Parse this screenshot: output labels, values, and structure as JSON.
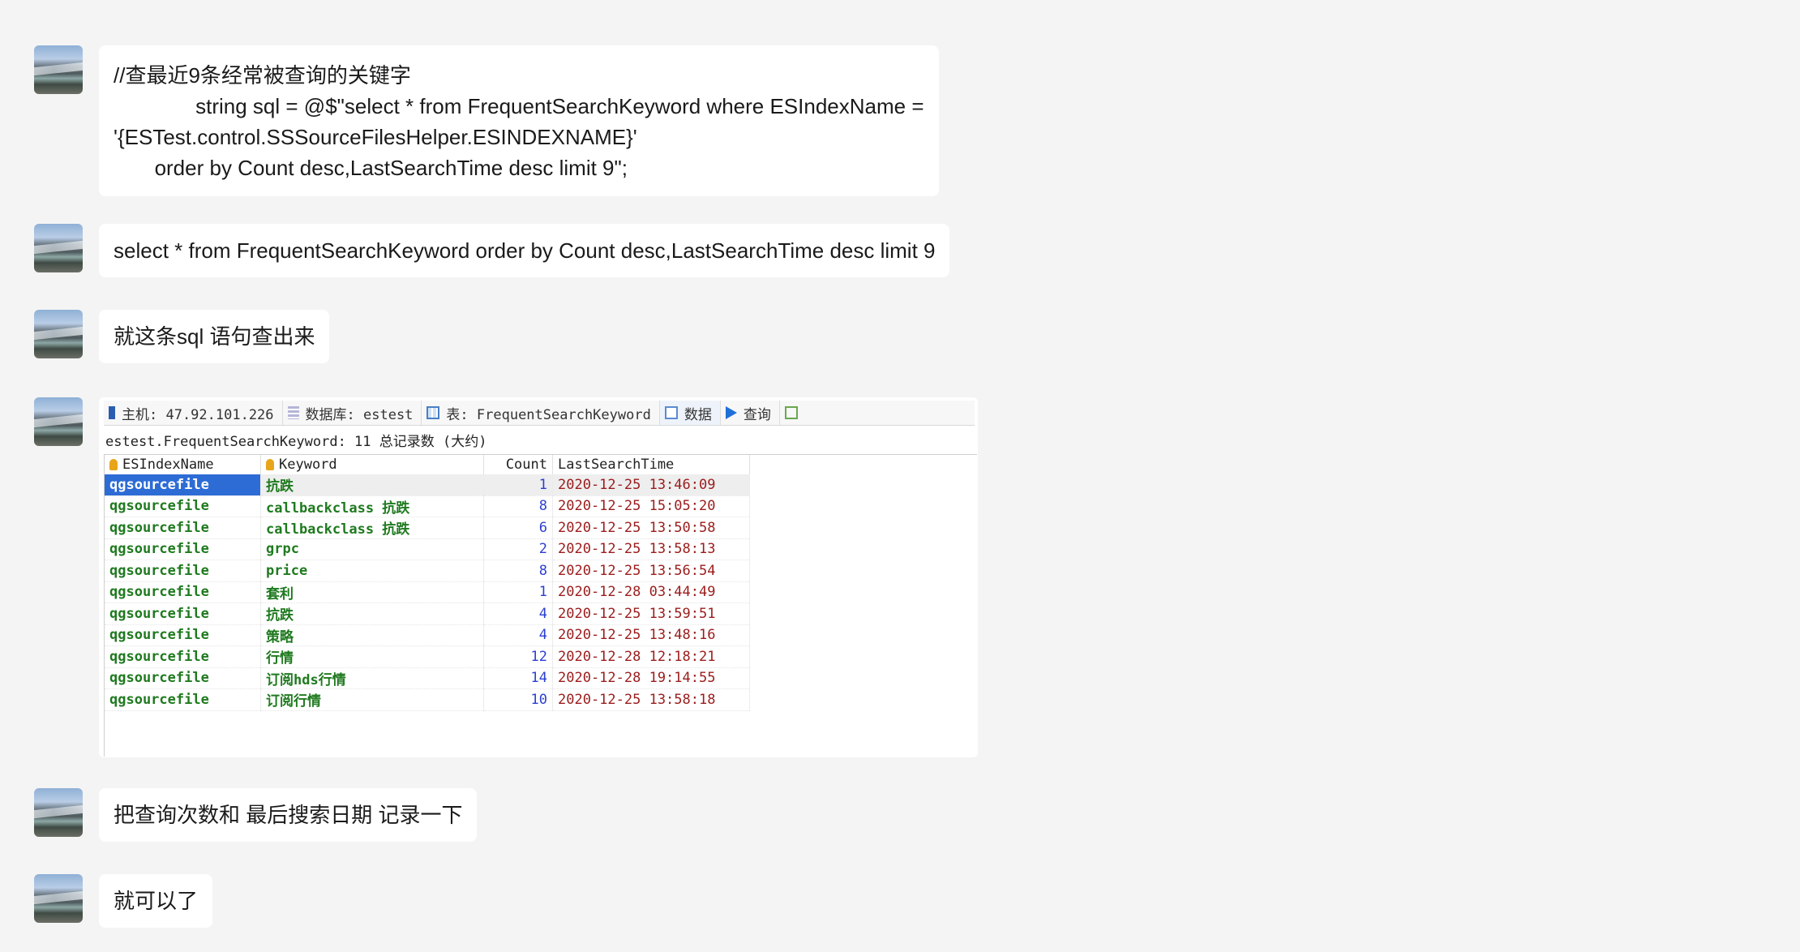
{
  "messages": [
    {
      "id": "m1",
      "text": "//查最近9条经常被查询的关键字\n              string sql = @$\"select * from FrequentSearchKeyword where ESIndexName =\n'{ESTest.control.SSSourceFilesHelper.ESINDEXNAME}'\n       order by Count desc,LastSearchTime desc limit 9\";"
    },
    {
      "id": "m2",
      "text": "select * from FrequentSearchKeyword order by Count desc,LastSearchTime desc limit 9"
    },
    {
      "id": "m3",
      "text": "就这条sql 语句查出来"
    },
    {
      "id": "m5",
      "text": "把查询次数和 最后搜索日期 记录一下"
    },
    {
      "id": "m6",
      "text": "就可以了"
    }
  ],
  "screenshot": {
    "toolbar": {
      "host": "主机: 47.92.101.226",
      "database": "数据库: estest",
      "table": "表: FrequentSearchKeyword",
      "data": "数据",
      "query": "查询"
    },
    "subtitle": "estest.FrequentSearchKeyword: 11 总记录数 (大约)",
    "columns": [
      "ESIndexName",
      "Keyword",
      "Count",
      "LastSearchTime"
    ],
    "rows": [
      [
        "qgsourcefile",
        " 抗跌",
        "1",
        "2020-12-25 13:46:09"
      ],
      [
        "qgsourcefile",
        "callbackclass 抗跌",
        "8",
        "2020-12-25 15:05:20"
      ],
      [
        "qgsourcefile",
        "callbackclass 抗跌",
        "6",
        "2020-12-25 13:50:58"
      ],
      [
        "qgsourcefile",
        "grpc",
        "2",
        "2020-12-25 13:58:13"
      ],
      [
        "qgsourcefile",
        "price",
        "8",
        "2020-12-25 13:56:54"
      ],
      [
        "qgsourcefile",
        "套利",
        "1",
        "2020-12-28 03:44:49"
      ],
      [
        "qgsourcefile",
        "抗跌",
        "4",
        "2020-12-25 13:59:51"
      ],
      [
        "qgsourcefile",
        "策略",
        "4",
        "2020-12-25 13:48:16"
      ],
      [
        "qgsourcefile",
        "行情",
        "12",
        "2020-12-28 12:18:21"
      ],
      [
        "qgsourcefile",
        "订阅hds行情",
        "14",
        "2020-12-28 19:14:55"
      ],
      [
        "qgsourcefile",
        "订阅行情",
        "10",
        "2020-12-25 13:58:18"
      ]
    ]
  }
}
